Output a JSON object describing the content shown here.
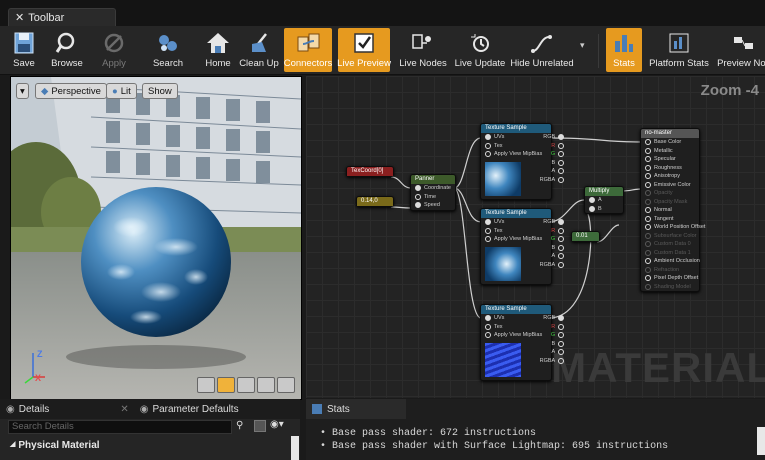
{
  "window": {
    "tab_label": "Toolbar"
  },
  "toolbar": {
    "save": "Save",
    "browse": "Browse",
    "apply": "Apply",
    "search": "Search",
    "home": "Home",
    "clean_up": "Clean Up",
    "connectors": "Connectors",
    "live_preview": "Live Preview",
    "live_nodes": "Live Nodes",
    "live_update": "Live Update",
    "hide_unrelated": "Hide Unrelated",
    "stats": "Stats",
    "platform_stats": "Platform Stats",
    "preview_nodes": "Preview Nod"
  },
  "viewport": {
    "perspective": "Perspective",
    "lit": "Lit",
    "show": "Show",
    "axis_z": "Z",
    "axis_x": "X"
  },
  "graph": {
    "zoom": "Zoom -4",
    "watermark": "MATERIAL",
    "texcoord": "TexCoord[0]",
    "const_vec": "0.14,0",
    "panner": {
      "title": "Panner",
      "pins": [
        "Coordinate",
        "Time",
        "Speed"
      ]
    },
    "texture_sample": {
      "title": "Texture Sample",
      "inputs": [
        "UVs",
        "Tex",
        "Apply View MipBias"
      ],
      "outputs": [
        "RGB",
        "R",
        "G",
        "B",
        "A",
        "RGBA"
      ]
    },
    "multiply": {
      "title": "Multiply",
      "pins": [
        "A",
        "B"
      ]
    },
    "const_scalar": "0.01",
    "result": {
      "title": "no-master",
      "pins": [
        "Base Color",
        "Metallic",
        "Specular",
        "Roughness",
        "Anisotropy",
        "Emissive Color",
        "Opacity",
        "Opacity Mask",
        "Normal",
        "Tangent",
        "World Position Offset",
        "Subsurface Color",
        "Custom Data 0",
        "Custom Data 1",
        "Ambient Occlusion",
        "Refraction",
        "Pixel Depth Offset",
        "Shading Model"
      ],
      "dim": [
        false,
        false,
        false,
        false,
        false,
        false,
        true,
        true,
        false,
        false,
        false,
        true,
        true,
        true,
        false,
        true,
        false,
        true
      ]
    }
  },
  "details": {
    "tab": "Details",
    "param_tab": "Parameter Defaults",
    "search_placeholder": "Search Details",
    "category": "Physical Material"
  },
  "stats": {
    "tab": "Stats",
    "lines": [
      "Base pass shader: 672 instructions",
      "Base pass shader with Surface Lightmap: 695 instructions"
    ]
  },
  "colors": {
    "accent": "#e69a1f",
    "node_texture": "#1f5a7a",
    "node_panner": "#3d5a2a",
    "node_multiply": "#3d6a3a",
    "node_const": "#8a1f1f",
    "node_vec": "#7a6a1a"
  }
}
